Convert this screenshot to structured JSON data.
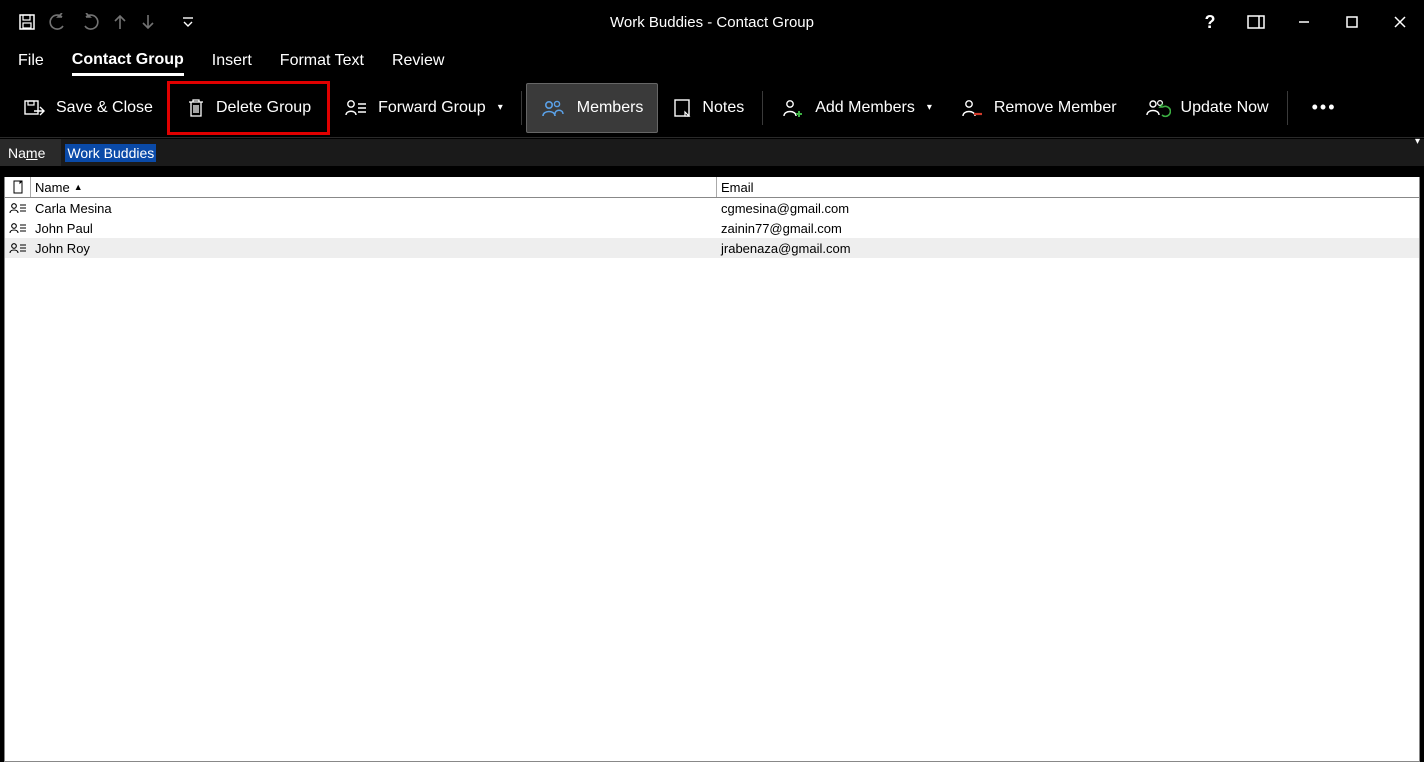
{
  "window": {
    "title": "Work Buddies  -  Contact Group"
  },
  "tabs": {
    "file": "File",
    "contact_group": "Contact Group",
    "insert": "Insert",
    "format_text": "Format Text",
    "review": "Review"
  },
  "ribbon": {
    "save_close": "Save & Close",
    "delete_group": "Delete Group",
    "forward_group": "Forward Group",
    "members": "Members",
    "notes": "Notes",
    "add_members": "Add Members",
    "remove_member": "Remove Member",
    "update_now": "Update Now"
  },
  "namebar": {
    "label_pre": "Na",
    "label_u": "m",
    "label_post": "e",
    "value": "Work Buddies"
  },
  "grid": {
    "col_name": "Name",
    "col_email": "Email",
    "rows": [
      {
        "name": "Carla Mesina",
        "email": "cgmesina@gmail.com"
      },
      {
        "name": "John Paul",
        "email": "zainin77@gmail.com"
      },
      {
        "name": "John Roy",
        "email": "jrabenaza@gmail.com"
      }
    ]
  }
}
